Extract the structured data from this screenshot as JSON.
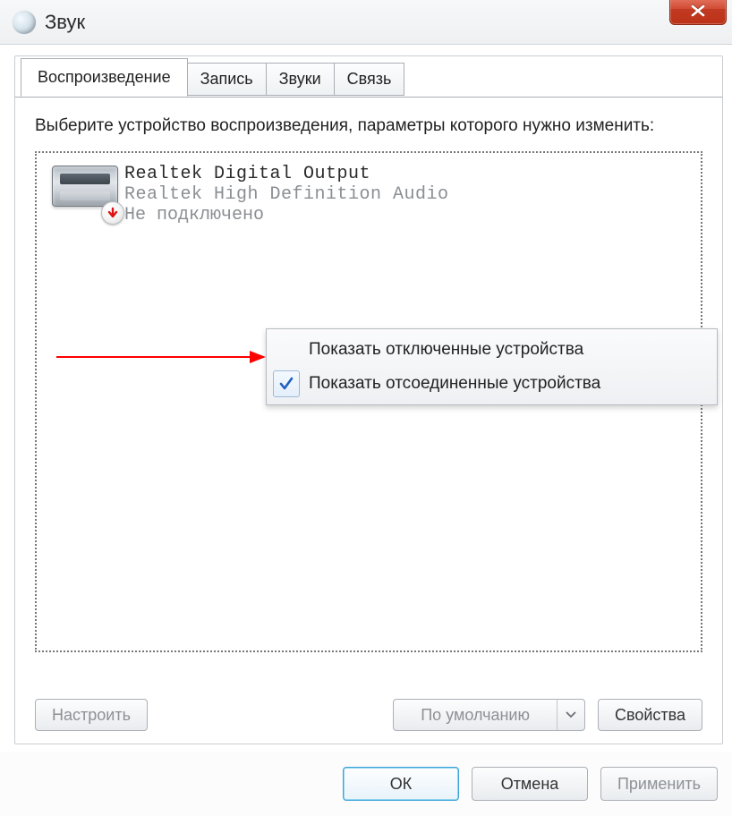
{
  "window": {
    "title": "Звук"
  },
  "tabs": [
    {
      "label": "Воспроизведение",
      "active": true
    },
    {
      "label": "Запись"
    },
    {
      "label": "Звуки"
    },
    {
      "label": "Связь"
    }
  ],
  "instruction": "Выберите устройство воспроизведения, параметры которого нужно изменить:",
  "device": {
    "name": "Realtek Digital Output",
    "driver": "Realtek High Definition Audio",
    "status": "Не подключено"
  },
  "context_menu": {
    "items": [
      {
        "label": "Показать отключенные устройства",
        "checked": false
      },
      {
        "label": "Показать отсоединенные устройства",
        "checked": true
      }
    ]
  },
  "buttons": {
    "configure": "Настроить",
    "default": "По умолчанию",
    "properties": "Свойства",
    "ok": "ОК",
    "cancel": "Отмена",
    "apply": "Применить"
  }
}
